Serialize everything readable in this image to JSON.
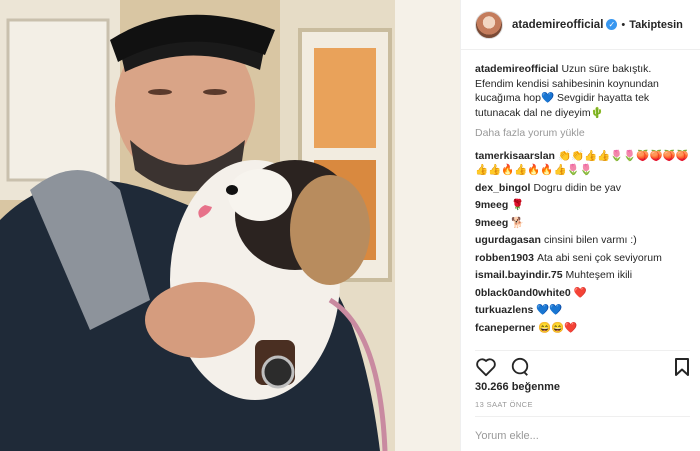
{
  "post": {
    "username": "atademireofficial",
    "separator": "•",
    "follow_label": "Takiptesin"
  },
  "caption": {
    "username": "atademireofficial",
    "text": "Uzun süre bakıştık. Efendim kendisi sahibesinin koynundan kucağıma hop💙 Sevgidir hayatta tek tutunacak dal ne diyeyim🌵"
  },
  "load_more_label": "Daha fazla yorum yükle",
  "comments": [
    {
      "user": "tamerkisaarslan",
      "text": "👏👏👍👍🌷🌷🍑🍑🍑🍑 👍👍🔥👍🔥🔥👍🌷🌷"
    },
    {
      "user": "dex_bingol",
      "text": "Dogru didin be yav"
    },
    {
      "user": "9meeg",
      "text": "🌹"
    },
    {
      "user": "9meeg",
      "text": "🐕"
    },
    {
      "user": "ugurdagasan",
      "text": "cinsini bilen varmı :)"
    },
    {
      "user": "robben1903",
      "text": "Ata abi seni çok seviyorum"
    },
    {
      "user": "ismail.bayindir.75",
      "text": "Muhteşem ikili"
    },
    {
      "user": "0black0and0white0",
      "text": "❤️"
    },
    {
      "user": "turkuazlens",
      "text": "💙💙"
    },
    {
      "user": "fcaneperner",
      "text": "😄😄❤️"
    }
  ],
  "stats": {
    "likes": "30.266 beğenme",
    "time": "13 SAAT ÖNCE"
  },
  "add_comment_placeholder": "Yorum ekle...",
  "icons": {
    "like": "heart-icon",
    "comment": "comment-bubble-icon",
    "save": "bookmark-icon",
    "verified": "verified-badge-icon"
  },
  "colors": {
    "verified_blue": "#3897f0",
    "meta_gray": "#999999",
    "text": "#262626"
  }
}
